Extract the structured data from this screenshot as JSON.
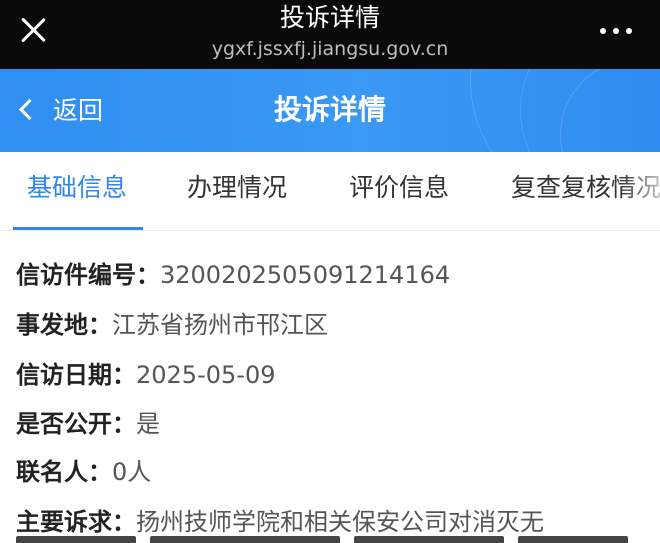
{
  "browser": {
    "title": "投诉详情",
    "url": "ygxf.jssxfj.jiangsu.gov.cn"
  },
  "header": {
    "back_label": "返回",
    "title": "投诉详情"
  },
  "tabs": [
    {
      "label": "基础信息",
      "active": true
    },
    {
      "label": "办理情况",
      "active": false
    },
    {
      "label": "评价信息",
      "active": false
    },
    {
      "label": "复查复核情况",
      "active": false
    }
  ],
  "details": [
    {
      "label": "信访件编号：",
      "value": "32002025050912141​64"
    },
    {
      "label": "事发地：",
      "value": "江苏省扬州市邗江区"
    },
    {
      "label": "信访日期：",
      "value": "2025-05-09"
    },
    {
      "label": "是否公开：",
      "value": "是"
    },
    {
      "label": "联名人：",
      "value": "0人"
    },
    {
      "label": "主要诉求：",
      "value": "扬州技师学院和相关保安公司对消灭无"
    }
  ],
  "colors": {
    "browser_bar": "#0a0a0a",
    "header_blue": "#3a99f4",
    "accent": "#2f87ef"
  },
  "icons": {
    "close": "close-icon",
    "more": "more-dots-icon",
    "back": "chevron-left-icon"
  }
}
